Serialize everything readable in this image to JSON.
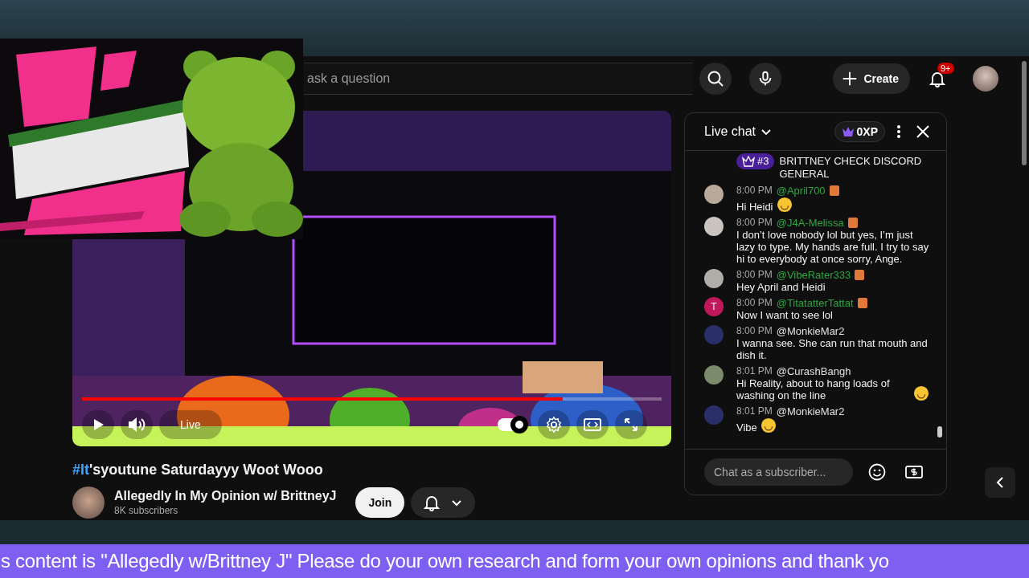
{
  "header": {
    "search": {
      "placeholder": "ask a question"
    },
    "create_label": "Create",
    "notification_badge": "9+"
  },
  "player": {
    "progress": {
      "level": 0.83
    },
    "live_label": "Live",
    "autoplay": true
  },
  "video": {
    "title": {
      "hashtag": "#It",
      "text": "'syoutune Saturdayyy Woot Wooo"
    },
    "channel": {
      "name": "Allegedly In My Opinion w/ BrittneyJ",
      "subscribers": "8K subscribers"
    },
    "join_label": "Join"
  },
  "live_chat": {
    "title": "Live chat",
    "xp": "0XP",
    "messages": [
      {
        "kind": "ranked",
        "rank": "#3",
        "text": "BRITTNEY CHECK DISCORD GENERAL"
      },
      {
        "kind": "chat",
        "time": "8:00 PM",
        "author": "@April700",
        "member": true,
        "badge": true,
        "text": "Hi Heidi",
        "emoji": true
      },
      {
        "kind": "chat",
        "time": "8:00 PM",
        "author": "@J4A-Melissa",
        "member": true,
        "badge": true,
        "text": "I don’t love nobody lol but yes, I’m just lazy to type. My hands are full. I try to say hi to everybody at once sorry, Ange."
      },
      {
        "kind": "chat",
        "time": "8:00 PM",
        "author": "@VibeRater333",
        "member": true,
        "badge": true,
        "text": "Hey April and Heidi"
      },
      {
        "kind": "chat",
        "time": "8:00 PM",
        "author": "@TitatatterTattat",
        "member": true,
        "badge": true,
        "initial": "T",
        "text": "Now I want to see lol"
      },
      {
        "kind": "chat",
        "time": "8:00 PM",
        "author": "@MonkieMar2",
        "member": false,
        "badge": false,
        "text": "I wanna see. She can run that mouth and dish it."
      },
      {
        "kind": "chat",
        "time": "8:01 PM",
        "author": "@CurashBangh",
        "member": false,
        "badge": false,
        "text": "Hi Reality, about to hang loads of washing on the line",
        "emoji": true
      },
      {
        "kind": "chat",
        "time": "8:01 PM",
        "author": "@MonkieMar2",
        "member": false,
        "badge": false,
        "text": "Vibe",
        "emoji": true
      }
    ],
    "input": {
      "placeholder": "Chat as a subscriber..."
    }
  },
  "ticker": "s content is \"Allegedly w/Brittney J\" Please do your own research and form your own opinions and thank yo"
}
